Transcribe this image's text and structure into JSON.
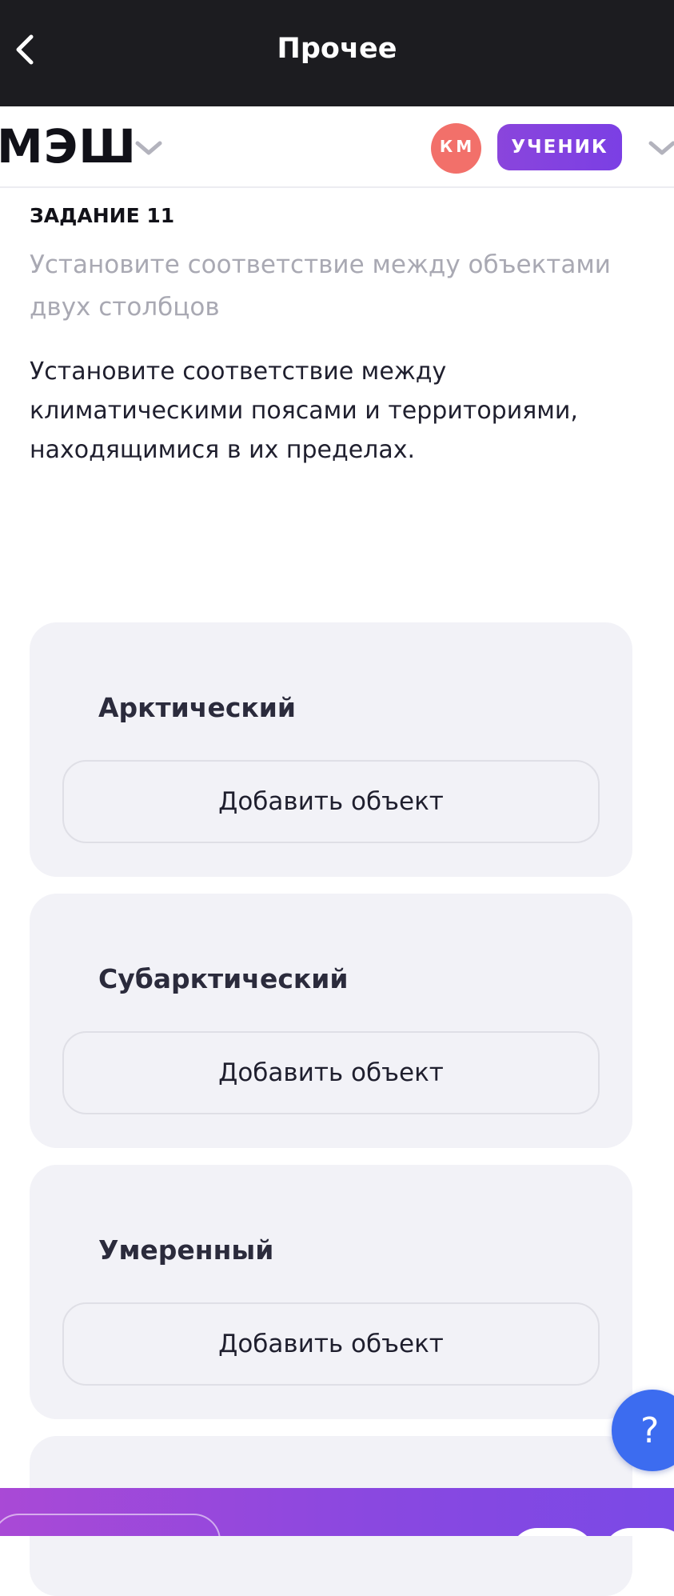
{
  "topbar": {
    "back_icon": "chevron-left-icon",
    "title": "Прочее"
  },
  "header": {
    "logo": "МЭШ",
    "logo_chevron_icon": "chevron-down-icon",
    "avatar_initials": "КМ",
    "avatar_color": "#f2706a",
    "role_label": "УЧЕНИК",
    "role_color": "#8a45dc",
    "menu_chevron_icon": "chevron-down-icon"
  },
  "task": {
    "label": "ЗАДАНИЕ 11",
    "hint": "Установите соответствие между объектами двух столбцов",
    "text": "Установите соответствие между климатическими поясами и территориями, находящимися в их пределах."
  },
  "zones": [
    {
      "title": "Арктический",
      "button_label": "Добавить объект"
    },
    {
      "title": "Субарктический",
      "button_label": "Добавить объект"
    },
    {
      "title": "Умеренный",
      "button_label": "Добавить объект"
    }
  ],
  "help_button": {
    "label": "?",
    "color": "#3c6cf0"
  },
  "bottom_bar": {
    "gradient": [
      "#a949d6",
      "#7a49e6"
    ]
  }
}
